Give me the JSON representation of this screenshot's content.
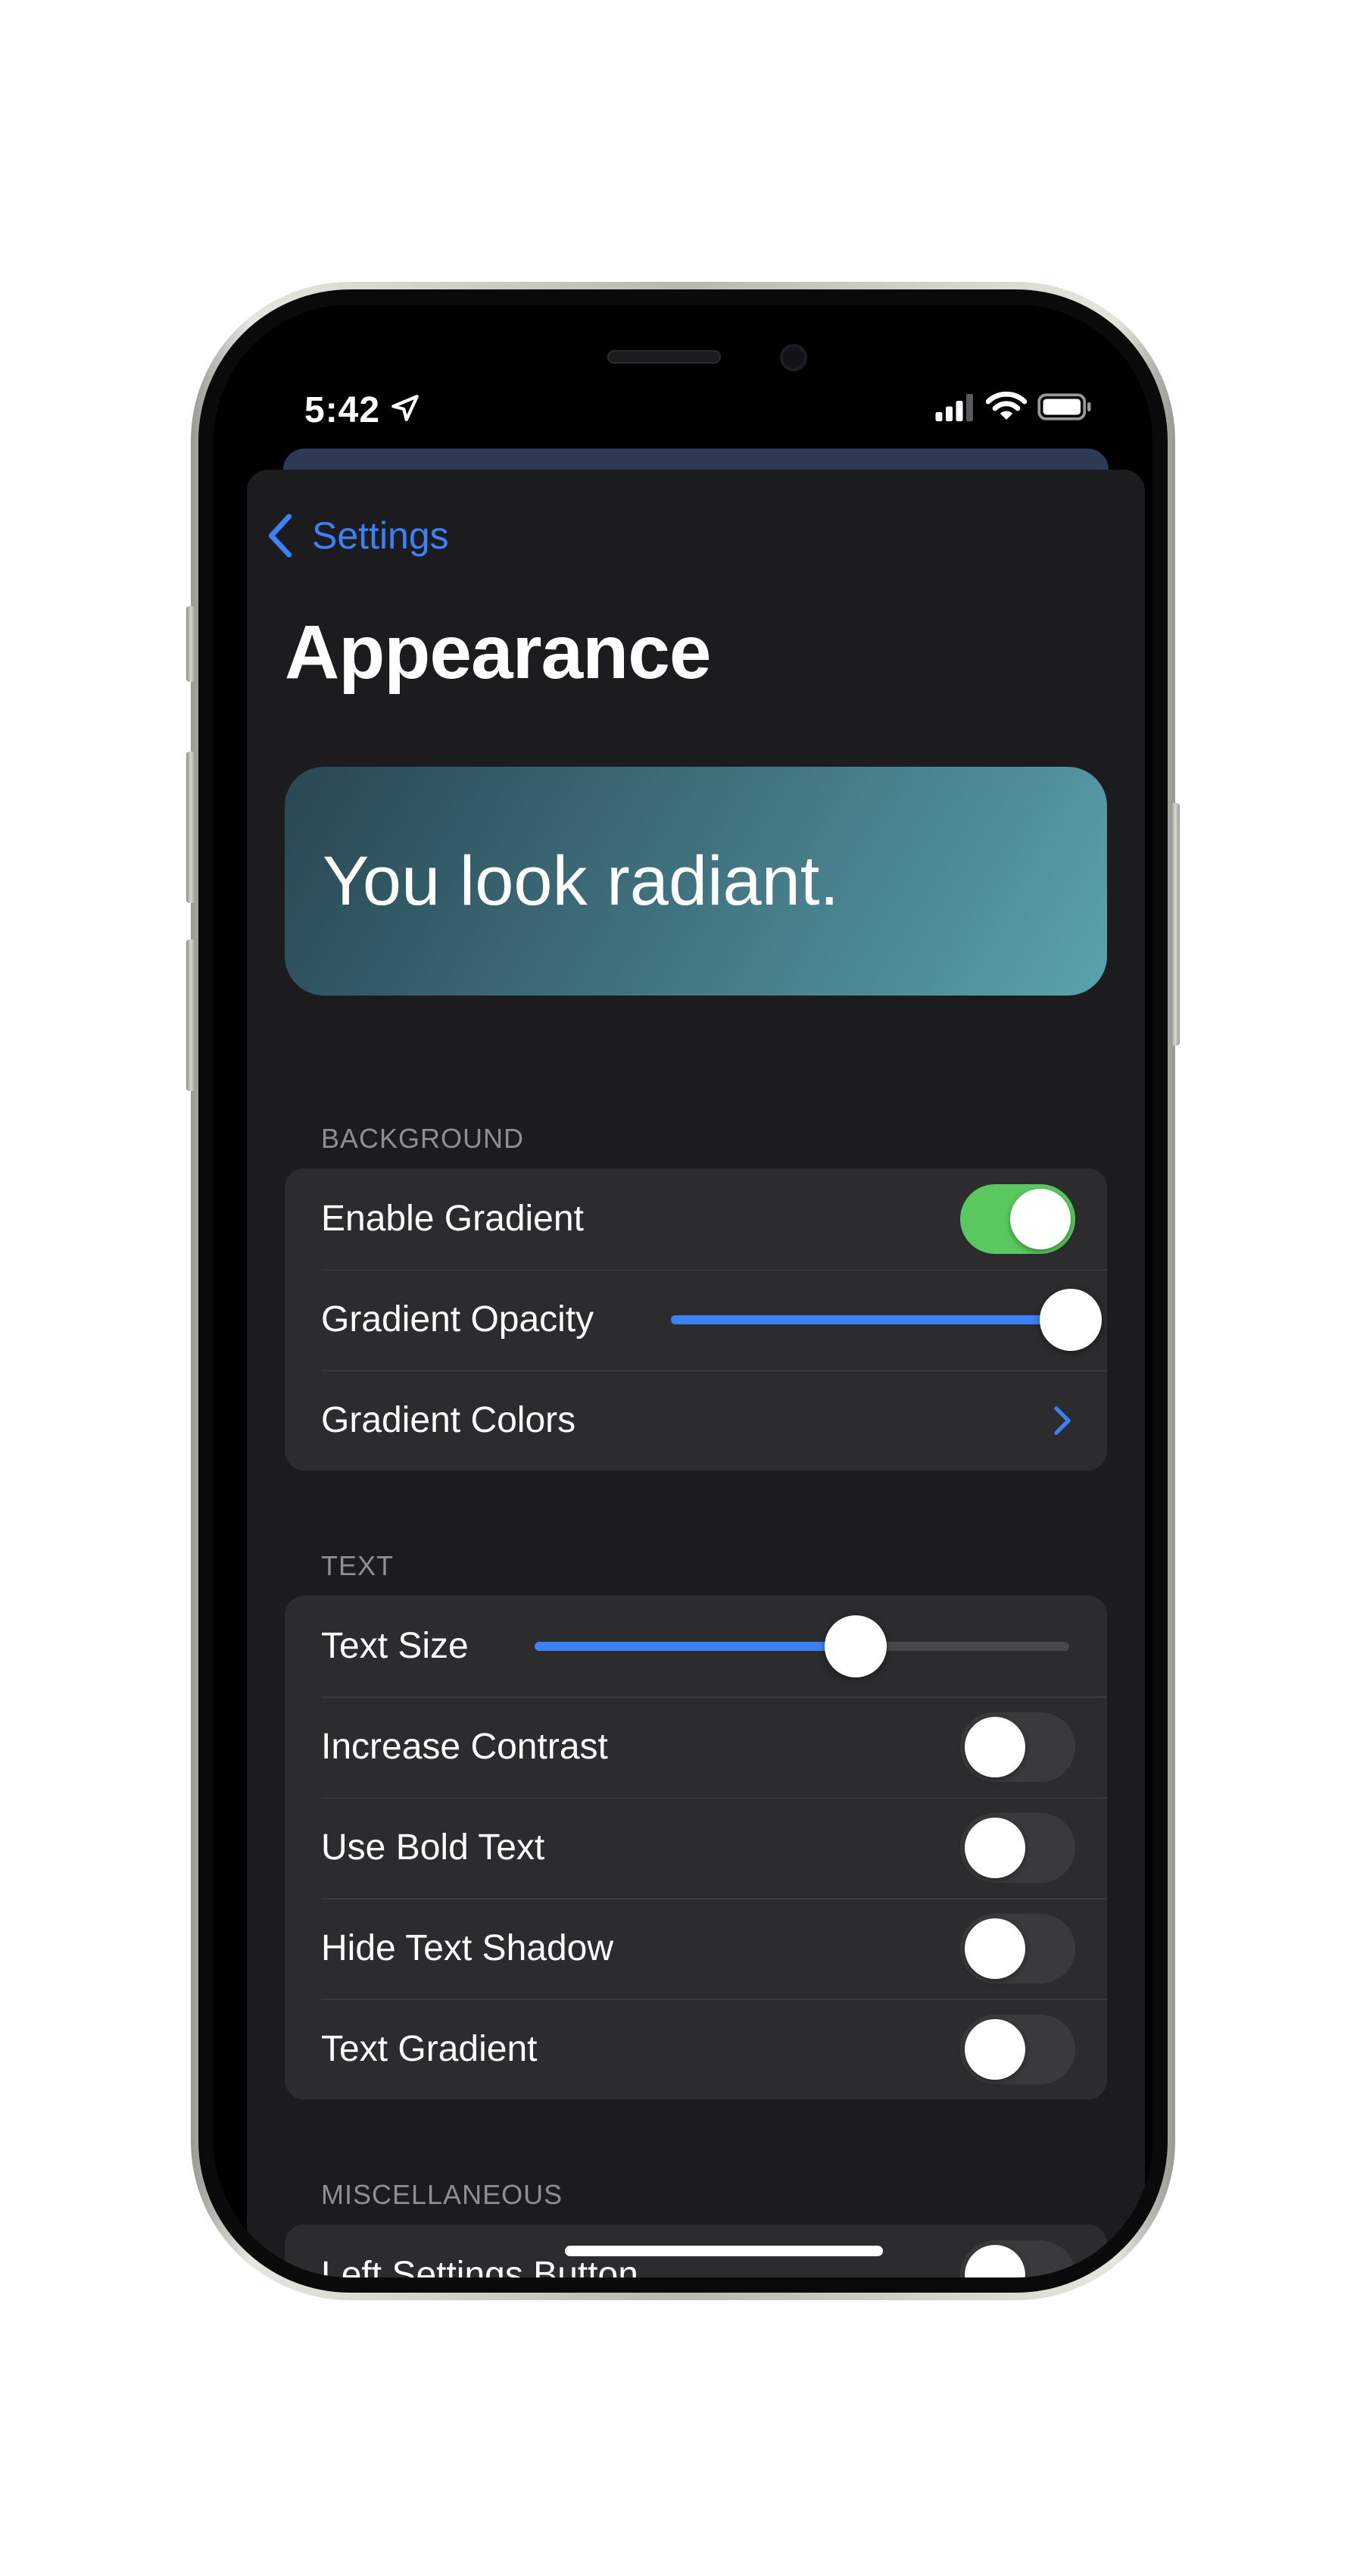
{
  "status_bar": {
    "time": "5:42",
    "location_icon": "location-arrow-icon",
    "signal_icon": "cellular-signal-icon",
    "wifi_icon": "wifi-icon",
    "battery_icon": "battery-icon"
  },
  "nav": {
    "back_label": "Settings",
    "back_icon": "chevron-left-icon"
  },
  "page_title": "Appearance",
  "preview": {
    "text": "You look radiant.",
    "gradient_colors": [
      "#284752",
      "#5aa2ad"
    ]
  },
  "sections": {
    "background": {
      "header": "BACKGROUND",
      "enable_gradient": {
        "label": "Enable Gradient",
        "on": true
      },
      "gradient_opacity": {
        "label": "Gradient Opacity",
        "value": 1.0
      },
      "gradient_colors": {
        "label": "Gradient Colors",
        "icon": "chevron-right-icon"
      }
    },
    "text": {
      "header": "TEXT",
      "text_size": {
        "label": "Text Size",
        "value": 0.6
      },
      "increase_contrast": {
        "label": "Increase Contrast",
        "on": false
      },
      "use_bold_text": {
        "label": "Use Bold Text",
        "on": false
      },
      "hide_text_shadow": {
        "label": "Hide Text Shadow",
        "on": false
      },
      "text_gradient": {
        "label": "Text Gradient",
        "on": false
      }
    },
    "miscellaneous": {
      "header": "MISCELLANEOUS",
      "left_settings_button": {
        "label": "Left Settings Button",
        "on": false
      }
    }
  },
  "colors": {
    "accent": "#3b82f6",
    "toggle_on": "#5ac85f",
    "sheet_background": "#1c1c1e",
    "group_background": "#2c2c2e"
  }
}
